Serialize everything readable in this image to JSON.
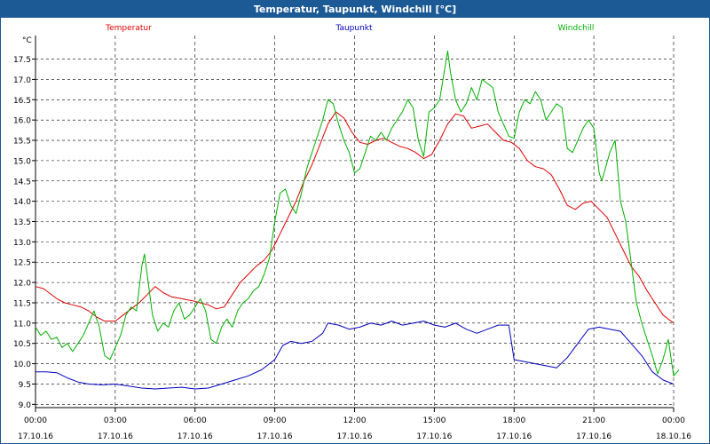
{
  "window": {
    "title": "Temperatur, Taupunkt, Windchill [°C]"
  },
  "chart_data": {
    "type": "line",
    "title": "Temperatur, Taupunkt, Windchill [°C]",
    "ylabel": "°C",
    "xlabel": "",
    "ylim": [
      9.0,
      18.0
    ],
    "xlim": [
      0,
      24
    ],
    "grid": true,
    "legend_position": "top",
    "y_ticks": [
      9.0,
      9.5,
      10.0,
      10.5,
      11.0,
      11.5,
      12.0,
      12.5,
      13.0,
      13.5,
      14.0,
      14.5,
      15.0,
      15.5,
      16.0,
      16.5,
      17.0,
      17.5
    ],
    "y_tick_labels": [
      "9.0",
      "9.5",
      "10.0",
      "10.5",
      "11.0",
      "11.5",
      "12.0",
      "12.5",
      "13.0",
      "13.5",
      "14.0",
      "14.5",
      "15.0",
      "15.5",
      "16.0",
      "16.5",
      "17.0",
      "17.5"
    ],
    "x_ticks": [
      {
        "hours": 0,
        "time": "00:00",
        "date": "17.10.16"
      },
      {
        "hours": 3,
        "time": "03:00",
        "date": "17.10.16"
      },
      {
        "hours": 6,
        "time": "06:00",
        "date": "17.10.16"
      },
      {
        "hours": 9,
        "time": "09:00",
        "date": "17.10.16"
      },
      {
        "hours": 12,
        "time": "12:00",
        "date": "17.10.16"
      },
      {
        "hours": 15,
        "time": "15:00",
        "date": "17.10.16"
      },
      {
        "hours": 18,
        "time": "18:00",
        "date": "17.10.16"
      },
      {
        "hours": 21,
        "time": "21:00",
        "date": "17.10.16"
      },
      {
        "hours": 24,
        "time": "00:00",
        "date": "18.10.16"
      }
    ],
    "series": [
      {
        "name": "Temperatur",
        "color": "#e00000",
        "points": [
          [
            0,
            11.9
          ],
          [
            0.3,
            11.85
          ],
          [
            0.5,
            11.75
          ],
          [
            0.8,
            11.6
          ],
          [
            1.1,
            11.5
          ],
          [
            1.4,
            11.45
          ],
          [
            1.7,
            11.4
          ],
          [
            2.0,
            11.3
          ],
          [
            2.3,
            11.15
          ],
          [
            2.6,
            11.05
          ],
          [
            3.0,
            11.05
          ],
          [
            3.3,
            11.2
          ],
          [
            3.6,
            11.35
          ],
          [
            3.9,
            11.5
          ],
          [
            4.2,
            11.7
          ],
          [
            4.5,
            11.9
          ],
          [
            4.8,
            11.75
          ],
          [
            5.1,
            11.65
          ],
          [
            5.5,
            11.6
          ],
          [
            5.9,
            11.55
          ],
          [
            6.2,
            11.5
          ],
          [
            6.5,
            11.45
          ],
          [
            6.8,
            11.35
          ],
          [
            7.1,
            11.4
          ],
          [
            7.4,
            11.7
          ],
          [
            7.7,
            12.0
          ],
          [
            8.0,
            12.2
          ],
          [
            8.3,
            12.4
          ],
          [
            8.6,
            12.55
          ],
          [
            8.9,
            12.8
          ],
          [
            9.2,
            13.2
          ],
          [
            9.5,
            13.6
          ],
          [
            9.8,
            14.0
          ],
          [
            10.1,
            14.5
          ],
          [
            10.4,
            14.9
          ],
          [
            10.7,
            15.4
          ],
          [
            11.0,
            15.9
          ],
          [
            11.3,
            16.2
          ],
          [
            11.6,
            16.05
          ],
          [
            11.9,
            15.7
          ],
          [
            12.2,
            15.45
          ],
          [
            12.5,
            15.4
          ],
          [
            12.8,
            15.5
          ],
          [
            13.1,
            15.55
          ],
          [
            13.4,
            15.45
          ],
          [
            13.7,
            15.35
          ],
          [
            14.0,
            15.3
          ],
          [
            14.3,
            15.2
          ],
          [
            14.6,
            15.05
          ],
          [
            14.9,
            15.15
          ],
          [
            15.2,
            15.5
          ],
          [
            15.5,
            15.9
          ],
          [
            15.8,
            16.15
          ],
          [
            16.1,
            16.1
          ],
          [
            16.4,
            15.8
          ],
          [
            16.7,
            15.85
          ],
          [
            17.0,
            15.9
          ],
          [
            17.3,
            15.7
          ],
          [
            17.6,
            15.5
          ],
          [
            17.9,
            15.45
          ],
          [
            18.2,
            15.3
          ],
          [
            18.5,
            15.0
          ],
          [
            18.8,
            14.85
          ],
          [
            19.1,
            14.8
          ],
          [
            19.4,
            14.65
          ],
          [
            19.7,
            14.3
          ],
          [
            20.0,
            13.9
          ],
          [
            20.3,
            13.8
          ],
          [
            20.6,
            13.95
          ],
          [
            20.9,
            14.0
          ],
          [
            21.2,
            13.8
          ],
          [
            21.5,
            13.6
          ],
          [
            21.8,
            13.2
          ],
          [
            22.1,
            12.8
          ],
          [
            22.4,
            12.4
          ],
          [
            22.7,
            12.15
          ],
          [
            23.0,
            11.8
          ],
          [
            23.3,
            11.5
          ],
          [
            23.6,
            11.2
          ],
          [
            24.0,
            11.0
          ]
        ]
      },
      {
        "name": "Taupunkt",
        "color": "#0000c0",
        "points": [
          [
            0,
            9.8
          ],
          [
            0.4,
            9.8
          ],
          [
            0.8,
            9.78
          ],
          [
            1.2,
            9.65
          ],
          [
            1.6,
            9.55
          ],
          [
            2.0,
            9.5
          ],
          [
            2.5,
            9.48
          ],
          [
            3.0,
            9.5
          ],
          [
            3.5,
            9.45
          ],
          [
            4.0,
            9.4
          ],
          [
            4.5,
            9.38
          ],
          [
            5.0,
            9.4
          ],
          [
            5.5,
            9.42
          ],
          [
            6.0,
            9.38
          ],
          [
            6.5,
            9.4
          ],
          [
            7.0,
            9.5
          ],
          [
            7.5,
            9.6
          ],
          [
            8.0,
            9.7
          ],
          [
            8.5,
            9.85
          ],
          [
            9.0,
            10.1
          ],
          [
            9.3,
            10.45
          ],
          [
            9.6,
            10.55
          ],
          [
            10.0,
            10.5
          ],
          [
            10.4,
            10.55
          ],
          [
            10.8,
            10.75
          ],
          [
            11.0,
            11.0
          ],
          [
            11.4,
            10.95
          ],
          [
            11.8,
            10.85
          ],
          [
            12.2,
            10.9
          ],
          [
            12.6,
            11.0
          ],
          [
            13.0,
            10.95
          ],
          [
            13.4,
            11.05
          ],
          [
            13.8,
            10.95
          ],
          [
            14.2,
            11.0
          ],
          [
            14.6,
            11.05
          ],
          [
            15.0,
            10.95
          ],
          [
            15.4,
            10.9
          ],
          [
            15.8,
            11.0
          ],
          [
            16.2,
            10.85
          ],
          [
            16.6,
            10.75
          ],
          [
            17.0,
            10.85
          ],
          [
            17.4,
            10.95
          ],
          [
            17.8,
            10.95
          ],
          [
            18.0,
            10.1
          ],
          [
            18.4,
            10.05
          ],
          [
            18.8,
            10.0
          ],
          [
            19.2,
            9.95
          ],
          [
            19.6,
            9.9
          ],
          [
            20.0,
            10.15
          ],
          [
            20.4,
            10.5
          ],
          [
            20.8,
            10.85
          ],
          [
            21.2,
            10.9
          ],
          [
            21.6,
            10.85
          ],
          [
            22.0,
            10.8
          ],
          [
            22.4,
            10.5
          ],
          [
            22.8,
            10.2
          ],
          [
            23.2,
            9.8
          ],
          [
            23.6,
            9.6
          ],
          [
            24.0,
            9.5
          ]
        ]
      },
      {
        "name": "Windchill",
        "color": "#00b000",
        "points": [
          [
            0,
            10.9
          ],
          [
            0.2,
            10.7
          ],
          [
            0.4,
            10.8
          ],
          [
            0.6,
            10.6
          ],
          [
            0.8,
            10.65
          ],
          [
            1.0,
            10.4
          ],
          [
            1.2,
            10.5
          ],
          [
            1.4,
            10.3
          ],
          [
            1.6,
            10.5
          ],
          [
            1.8,
            10.7
          ],
          [
            2.0,
            11.0
          ],
          [
            2.2,
            11.3
          ],
          [
            2.4,
            10.9
          ],
          [
            2.6,
            10.2
          ],
          [
            2.8,
            10.1
          ],
          [
            3.0,
            10.4
          ],
          [
            3.2,
            10.7
          ],
          [
            3.4,
            11.2
          ],
          [
            3.6,
            11.4
          ],
          [
            3.8,
            11.3
          ],
          [
            4.0,
            12.4
          ],
          [
            4.1,
            12.7
          ],
          [
            4.2,
            12.2
          ],
          [
            4.4,
            11.2
          ],
          [
            4.6,
            10.8
          ],
          [
            4.8,
            11.0
          ],
          [
            5.0,
            10.9
          ],
          [
            5.2,
            11.3
          ],
          [
            5.4,
            11.5
          ],
          [
            5.6,
            11.1
          ],
          [
            5.8,
            11.2
          ],
          [
            6.0,
            11.4
          ],
          [
            6.2,
            11.6
          ],
          [
            6.4,
            11.3
          ],
          [
            6.6,
            10.6
          ],
          [
            6.8,
            10.5
          ],
          [
            7.0,
            10.9
          ],
          [
            7.2,
            11.1
          ],
          [
            7.4,
            10.9
          ],
          [
            7.6,
            11.3
          ],
          [
            7.8,
            11.5
          ],
          [
            8.0,
            11.6
          ],
          [
            8.2,
            11.8
          ],
          [
            8.4,
            11.9
          ],
          [
            8.6,
            12.2
          ],
          [
            8.8,
            12.6
          ],
          [
            9.0,
            13.5
          ],
          [
            9.2,
            14.2
          ],
          [
            9.4,
            14.3
          ],
          [
            9.6,
            13.9
          ],
          [
            9.8,
            13.7
          ],
          [
            10.0,
            14.2
          ],
          [
            10.2,
            14.8
          ],
          [
            10.4,
            15.2
          ],
          [
            10.6,
            15.6
          ],
          [
            10.8,
            16.0
          ],
          [
            11.0,
            16.5
          ],
          [
            11.2,
            16.4
          ],
          [
            11.4,
            15.9
          ],
          [
            11.6,
            15.5
          ],
          [
            11.8,
            15.2
          ],
          [
            12.0,
            14.7
          ],
          [
            12.2,
            14.8
          ],
          [
            12.4,
            15.2
          ],
          [
            12.6,
            15.6
          ],
          [
            12.8,
            15.5
          ],
          [
            13.0,
            15.7
          ],
          [
            13.2,
            15.5
          ],
          [
            13.4,
            15.8
          ],
          [
            13.6,
            16.0
          ],
          [
            13.8,
            16.2
          ],
          [
            14.0,
            16.5
          ],
          [
            14.2,
            16.3
          ],
          [
            14.4,
            15.5
          ],
          [
            14.6,
            15.1
          ],
          [
            14.8,
            16.2
          ],
          [
            15.0,
            16.3
          ],
          [
            15.2,
            16.5
          ],
          [
            15.4,
            17.3
          ],
          [
            15.5,
            17.7
          ],
          [
            15.6,
            17.2
          ],
          [
            15.8,
            16.5
          ],
          [
            16.0,
            16.2
          ],
          [
            16.2,
            16.4
          ],
          [
            16.4,
            16.8
          ],
          [
            16.6,
            16.5
          ],
          [
            16.8,
            17.0
          ],
          [
            17.0,
            16.9
          ],
          [
            17.2,
            16.8
          ],
          [
            17.4,
            16.2
          ],
          [
            17.6,
            15.9
          ],
          [
            17.8,
            15.6
          ],
          [
            18.0,
            15.55
          ],
          [
            18.2,
            16.2
          ],
          [
            18.4,
            16.5
          ],
          [
            18.6,
            16.4
          ],
          [
            18.8,
            16.7
          ],
          [
            19.0,
            16.5
          ],
          [
            19.2,
            16.0
          ],
          [
            19.4,
            16.2
          ],
          [
            19.6,
            16.4
          ],
          [
            19.8,
            16.3
          ],
          [
            20.0,
            15.3
          ],
          [
            20.2,
            15.2
          ],
          [
            20.4,
            15.5
          ],
          [
            20.6,
            15.8
          ],
          [
            20.8,
            16.0
          ],
          [
            21.0,
            15.8
          ],
          [
            21.2,
            14.7
          ],
          [
            21.3,
            14.5
          ],
          [
            21.6,
            15.2
          ],
          [
            21.8,
            15.5
          ],
          [
            22.0,
            14.0
          ],
          [
            22.2,
            13.5
          ],
          [
            22.4,
            12.5
          ],
          [
            22.6,
            11.5
          ],
          [
            22.8,
            11.0
          ],
          [
            23.0,
            10.6
          ],
          [
            23.2,
            10.2
          ],
          [
            23.4,
            9.75
          ],
          [
            23.6,
            10.1
          ],
          [
            23.8,
            10.6
          ],
          [
            24.0,
            9.7
          ],
          [
            24.2,
            9.85
          ]
        ]
      }
    ]
  }
}
